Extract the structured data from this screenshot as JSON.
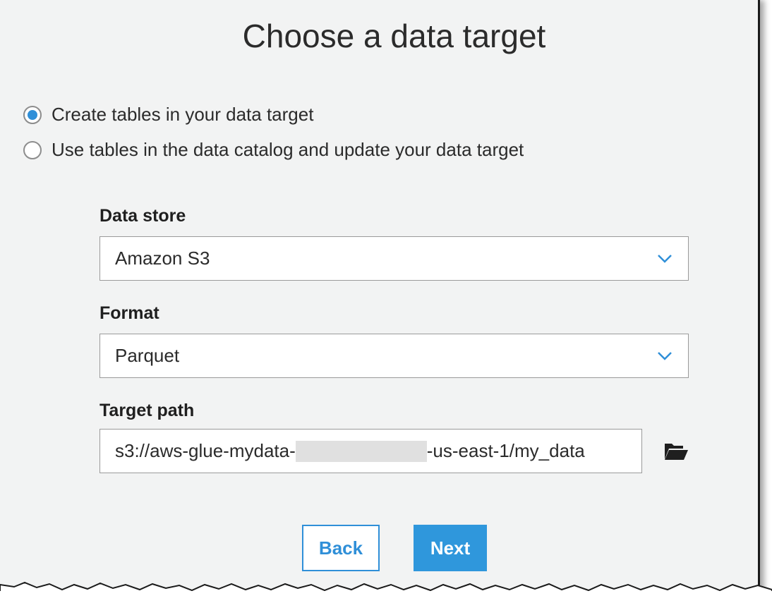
{
  "title": "Choose a data target",
  "radios": [
    {
      "label": "Create tables in your data target",
      "checked": true
    },
    {
      "label": "Use tables in the data catalog and update your data target",
      "checked": false
    }
  ],
  "data_store": {
    "label": "Data store",
    "value": "Amazon S3",
    "icon": "chevron-down-icon"
  },
  "format": {
    "label": "Format",
    "value": "Parquet",
    "icon": "chevron-down-icon"
  },
  "target_path": {
    "label": "Target path",
    "value_prefix": "s3://aws-glue-mydata-",
    "value_suffix": "-us-east-1/my_data",
    "browse_icon": "folder-open-icon"
  },
  "buttons": {
    "back": "Back",
    "next": "Next"
  },
  "colors": {
    "accent": "#2f97dc",
    "background": "#f2f3f3"
  }
}
